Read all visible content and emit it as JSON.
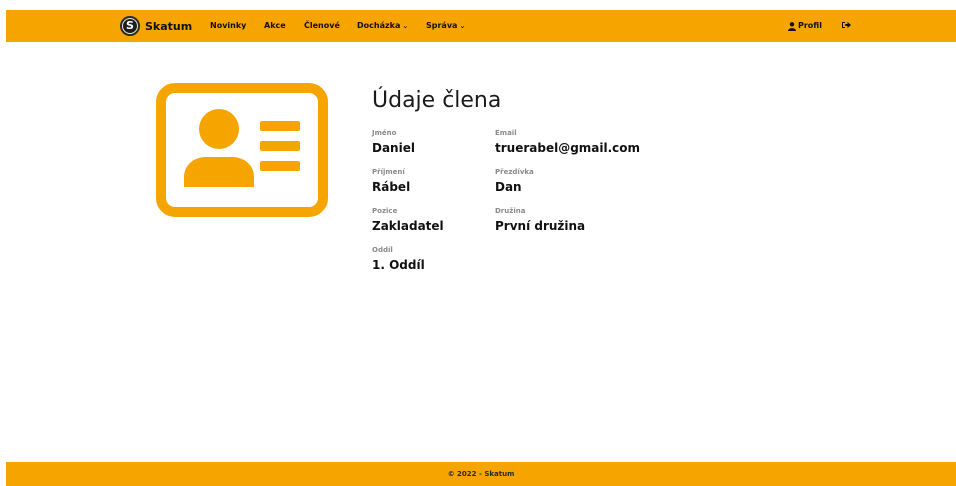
{
  "colors": {
    "accent": "#f5a400",
    "text": "#111111",
    "label": "#8a8a8a"
  },
  "nav": {
    "brand": "Skatum",
    "brand_letter": "S",
    "items": [
      {
        "label": "Novinky",
        "dropdown": false
      },
      {
        "label": "Akce",
        "dropdown": false
      },
      {
        "label": "Členové",
        "dropdown": false
      },
      {
        "label": "Docházka",
        "dropdown": true
      },
      {
        "label": "Správa",
        "dropdown": true
      }
    ],
    "profile_label": "Profil",
    "profile_icon": "user-icon",
    "logout_icon": "sign-out-icon",
    "dropdown_icon": "chevron-down-icon"
  },
  "member": {
    "title": "Údaje člena",
    "card_icon": "id-card-icon",
    "fields": [
      {
        "label": "Jméno",
        "value": "Daniel"
      },
      {
        "label": "Email",
        "value": "truerabel@gmail.com"
      },
      {
        "label": "Příjmení",
        "value": "Rábel"
      },
      {
        "label": "Přezdívka",
        "value": "Dan"
      },
      {
        "label": "Pozice",
        "value": "Zakladatel"
      },
      {
        "label": "Družina",
        "value": "První družina"
      },
      {
        "label": "Oddíl",
        "value": "1. Oddíl"
      }
    ]
  },
  "footer": {
    "text": "© 2022 - Skatum"
  }
}
